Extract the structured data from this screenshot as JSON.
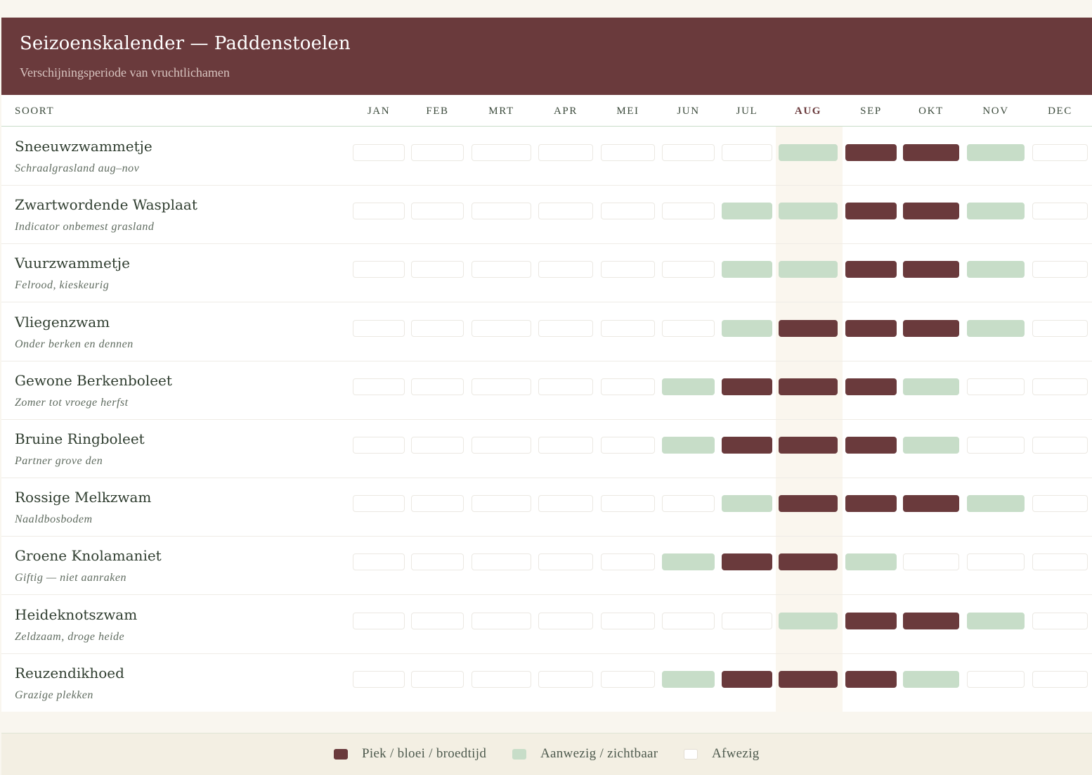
{
  "header": {
    "title": "Seizoenskalender — Paddenstoelen",
    "subtitle": "Verschijningsperiode van vruchtlichamen"
  },
  "table": {
    "species_column_label": "SOORT",
    "months": [
      "JAN",
      "FEB",
      "MRT",
      "APR",
      "MEI",
      "JUN",
      "JUL",
      "AUG",
      "SEP",
      "OKT",
      "NOV",
      "DEC"
    ],
    "current_month_index": 7,
    "rows": [
      {
        "name": "Sneeuwzwammetje",
        "note": "Schraalgrasland aug–nov",
        "months": [
          0,
          0,
          0,
          0,
          0,
          0,
          0,
          1,
          2,
          2,
          1,
          0
        ]
      },
      {
        "name": "Zwartwordende Wasplaat",
        "note": "Indicator onbemest grasland",
        "months": [
          0,
          0,
          0,
          0,
          0,
          0,
          1,
          1,
          2,
          2,
          1,
          0
        ]
      },
      {
        "name": "Vuurzwammetje",
        "note": "Felrood, kieskeurig",
        "months": [
          0,
          0,
          0,
          0,
          0,
          0,
          1,
          1,
          2,
          2,
          1,
          0
        ]
      },
      {
        "name": "Vliegenzwam",
        "note": "Onder berken en dennen",
        "months": [
          0,
          0,
          0,
          0,
          0,
          0,
          1,
          2,
          2,
          2,
          1,
          0
        ]
      },
      {
        "name": "Gewone Berkenboleet",
        "note": "Zomer tot vroege herfst",
        "months": [
          0,
          0,
          0,
          0,
          0,
          1,
          2,
          2,
          2,
          1,
          0,
          0
        ]
      },
      {
        "name": "Bruine Ringboleet",
        "note": "Partner grove den",
        "months": [
          0,
          0,
          0,
          0,
          0,
          1,
          2,
          2,
          2,
          1,
          0,
          0
        ]
      },
      {
        "name": "Rossige Melkzwam",
        "note": "Naaldbosbodem",
        "months": [
          0,
          0,
          0,
          0,
          0,
          0,
          1,
          2,
          2,
          2,
          1,
          0
        ]
      },
      {
        "name": "Groene Knolamaniet",
        "note": "Giftig — niet aanraken",
        "months": [
          0,
          0,
          0,
          0,
          0,
          1,
          2,
          2,
          1,
          0,
          0,
          0
        ]
      },
      {
        "name": "Heideknotszwam",
        "note": "Zeldzaam, droge heide",
        "months": [
          0,
          0,
          0,
          0,
          0,
          0,
          0,
          1,
          2,
          2,
          1,
          0
        ]
      },
      {
        "name": "Reuzendikhoed",
        "note": "Grazige plekken",
        "months": [
          0,
          0,
          0,
          0,
          0,
          1,
          2,
          2,
          2,
          1,
          0,
          0
        ]
      }
    ]
  },
  "legend": [
    {
      "label": "Piek / bloei / broedtijd",
      "state": 2
    },
    {
      "label": "Aanwezig / zichtbaar",
      "state": 1
    },
    {
      "label": "Afwezig",
      "state": 0
    }
  ],
  "colors": {
    "peak": "#6a3a3c",
    "present": "#c7ddc8",
    "absent": "#ffffff",
    "header_bg": "#6a3a3c"
  }
}
